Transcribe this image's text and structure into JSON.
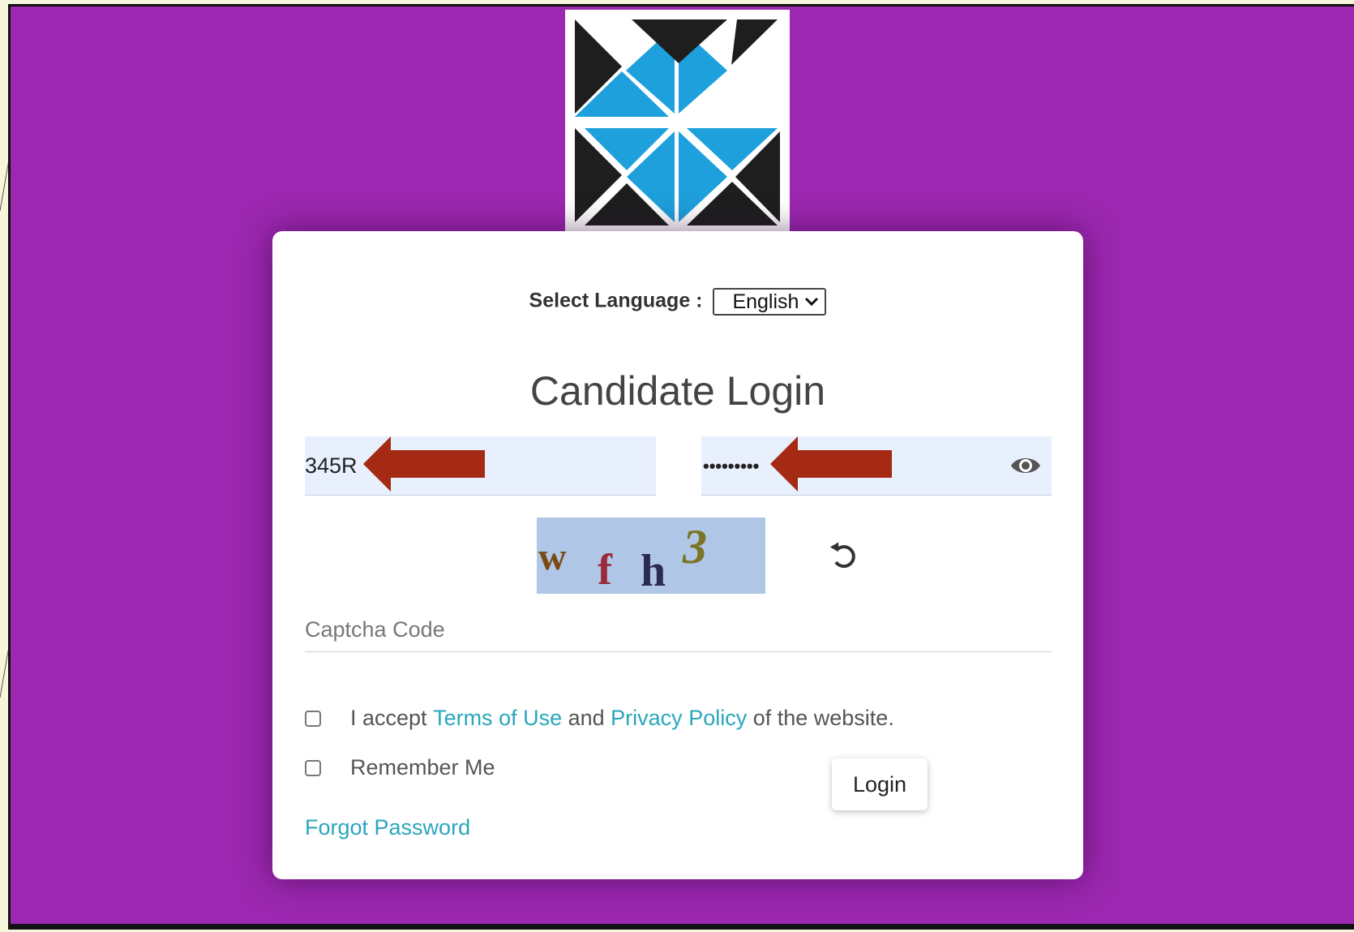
{
  "colors": {
    "background": "#9c27b0",
    "card": "#ffffff",
    "link": "#2aa6bc",
    "arrow": "#a52a13",
    "field_fill": "#e8f0fe"
  },
  "logo": {
    "icon": "triangles-logo-icon"
  },
  "language": {
    "label": "Select Language :",
    "selected": "English"
  },
  "title": "Candidate Login",
  "userid": {
    "value": "345R"
  },
  "password": {
    "masked_value": "•••••••••",
    "toggle_icon": "eye-icon"
  },
  "captcha": {
    "image_text": "wfh3",
    "refresh_icon": "refresh-icon",
    "placeholder": "Captcha Code"
  },
  "terms": {
    "prefix": "I accept ",
    "terms_link": "Terms of Use",
    "middle": " and ",
    "privacy_link": "Privacy Policy",
    "suffix": " of the website."
  },
  "remember": {
    "label": "Remember Me"
  },
  "login_button": "Login",
  "forgot_password": "Forgot Password"
}
